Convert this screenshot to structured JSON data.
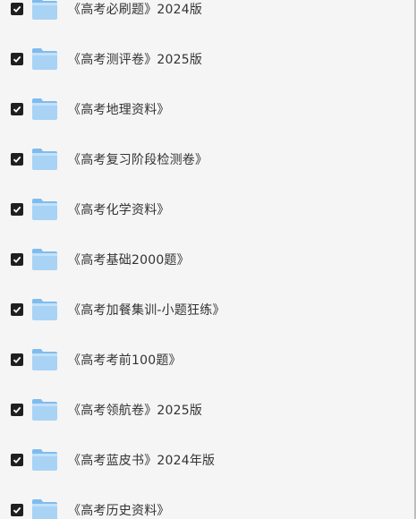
{
  "file_list": {
    "items": [
      {
        "name": "《高考必刷题》2024版",
        "checked": true
      },
      {
        "name": "《高考测评卷》2025版",
        "checked": true
      },
      {
        "name": "《高考地理资料》",
        "checked": true
      },
      {
        "name": "《高考复习阶段检测卷》",
        "checked": true
      },
      {
        "name": "《高考化学资料》",
        "checked": true
      },
      {
        "name": "《高考基础2000题》",
        "checked": true
      },
      {
        "name": "《高考加餐集训-小题狂练》",
        "checked": true
      },
      {
        "name": "《高考考前100题》",
        "checked": true
      },
      {
        "name": "《高考领航卷》2025版",
        "checked": true
      },
      {
        "name": "《高考蓝皮书》2024年版",
        "checked": true
      },
      {
        "name": "《高考历史资料》",
        "checked": true
      }
    ]
  },
  "icons": {
    "checkbox": "checkbox-checked-icon",
    "folder": "folder-icon"
  },
  "colors": {
    "background": "#f5f5f5",
    "checkbox": "#1f1f1f",
    "folder_light": "#aed6f6",
    "folder_dark": "#6fb3ea",
    "text": "#333333"
  }
}
